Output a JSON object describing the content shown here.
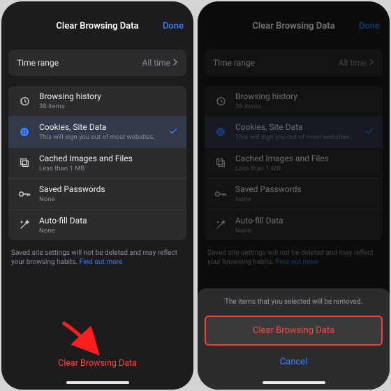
{
  "header": {
    "title": "Clear Browsing Data",
    "done": "Done"
  },
  "timeRange": {
    "label": "Time range",
    "value": "All time"
  },
  "items": [
    {
      "title": "Browsing history",
      "sub": "38 items",
      "icon": "history-icon",
      "selected": false
    },
    {
      "title": "Cookies, Site Data",
      "sub": "This will sign you out of most websites.",
      "icon": "cookie-icon",
      "selected": true
    },
    {
      "title": "Cached Images and Files",
      "sub": "Less than 1 MB",
      "icon": "cache-icon",
      "selected": false
    },
    {
      "title": "Saved Passwords",
      "sub": "None",
      "icon": "key-icon",
      "selected": false
    },
    {
      "title": "Auto-fill Data",
      "sub": "None",
      "icon": "wand-icon",
      "selected": false
    }
  ],
  "note": {
    "text": "Saved site settings will not be deleted and may reflect your browsing habits. ",
    "link": "Find out more"
  },
  "footer": {
    "clear": "Clear Browsing Data"
  },
  "sheet": {
    "msg": "The items that you selected will be removed.",
    "clear": "Clear Browsing Data",
    "cancel": "Cancel"
  }
}
